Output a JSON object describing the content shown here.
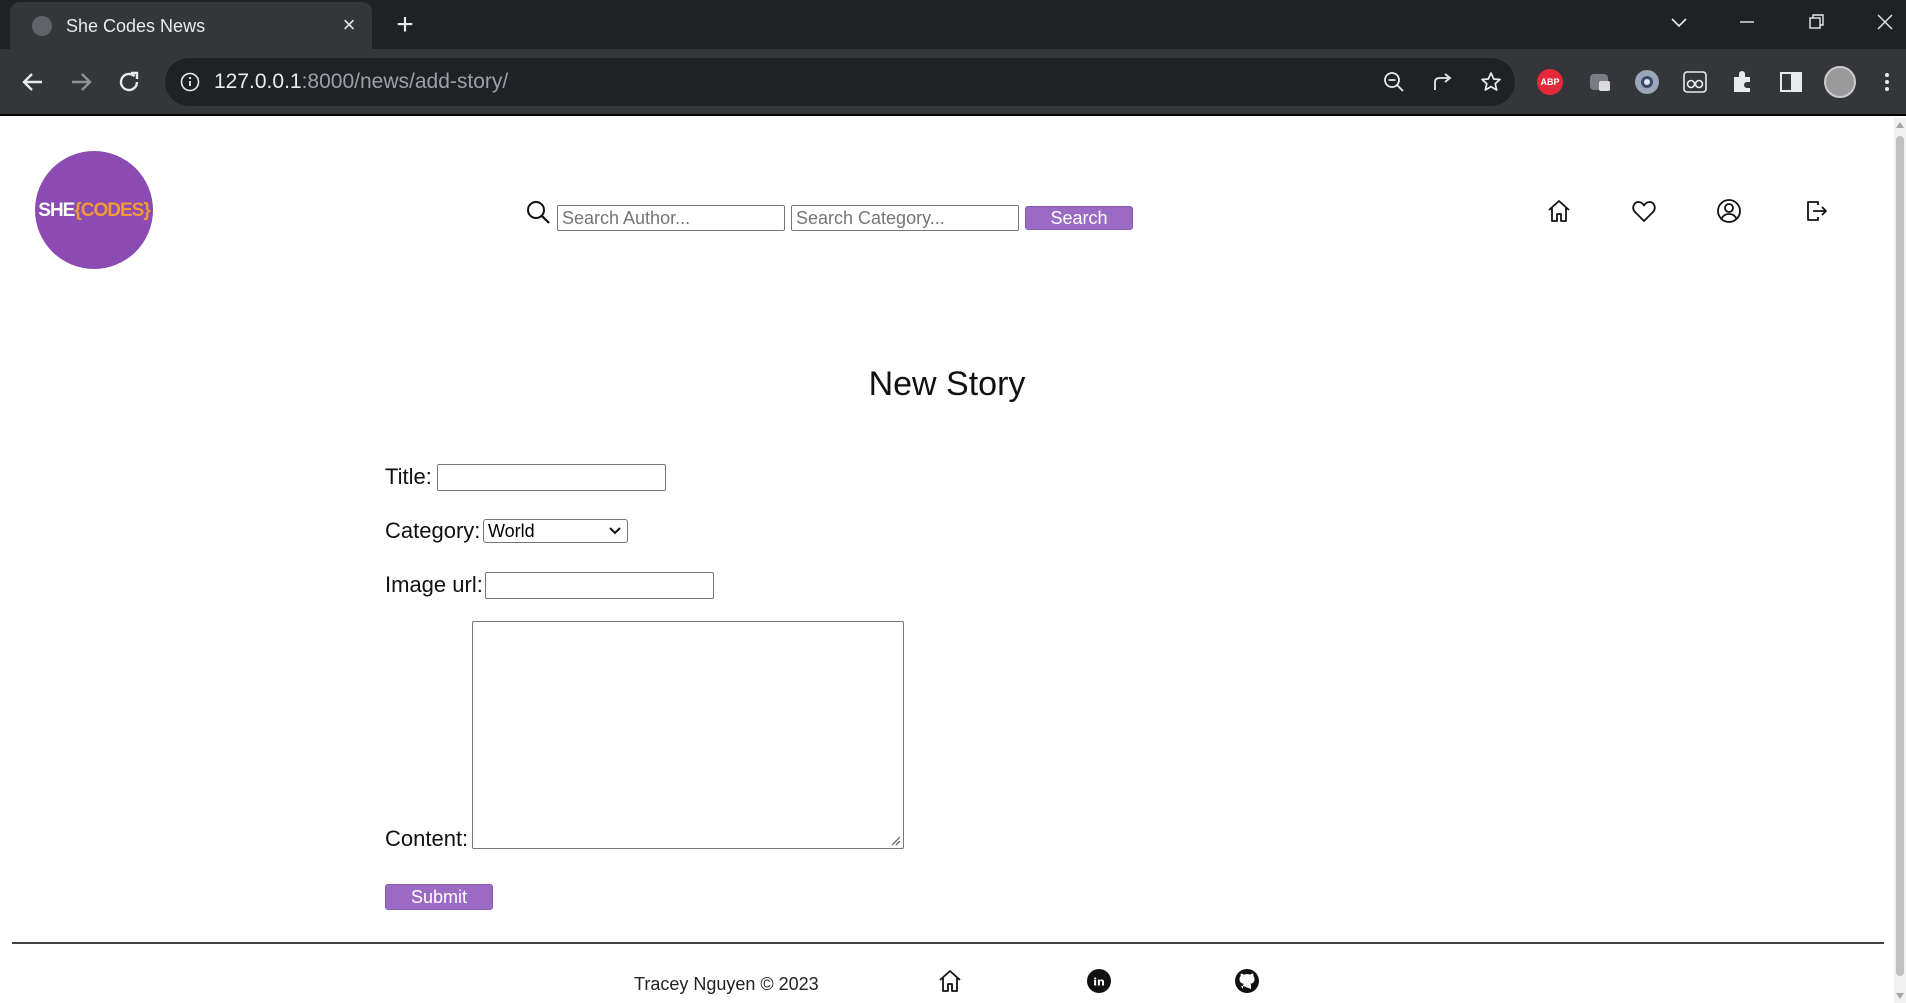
{
  "browser": {
    "tab_title": "She Codes News",
    "tab_close": "×",
    "new_tab": "+",
    "url_host": "127.0.0.1",
    "url_rest": ":8000/news/add-story/",
    "extensions": {
      "abp_label": "ABP"
    }
  },
  "header": {
    "logo": {
      "she": "SHE",
      "codes": "{CODES}"
    },
    "search": {
      "author_placeholder": "Search Author...",
      "category_placeholder": "Search Category...",
      "button_label": "Search"
    },
    "nav_icons": [
      "home-icon",
      "heart-icon",
      "user-icon",
      "logout-icon"
    ]
  },
  "form": {
    "heading": "New Story",
    "title_label": "Title:",
    "title_value": "",
    "category_label": "Category:",
    "category_value": "World",
    "image_label": "Image url:",
    "image_value": "",
    "content_label": "Content:",
    "content_value": "",
    "submit_label": "Submit"
  },
  "footer": {
    "text": "Tracey Nguyen  © 2023",
    "icons": [
      "home-icon",
      "linkedin-icon",
      "github-icon"
    ]
  },
  "colors": {
    "brand_purple": "#8c4bb3",
    "button_purple": "#9b6bc3",
    "logo_accent": "#f39a35",
    "chrome_dark": "#202124",
    "chrome_toolbar": "#35363a"
  }
}
